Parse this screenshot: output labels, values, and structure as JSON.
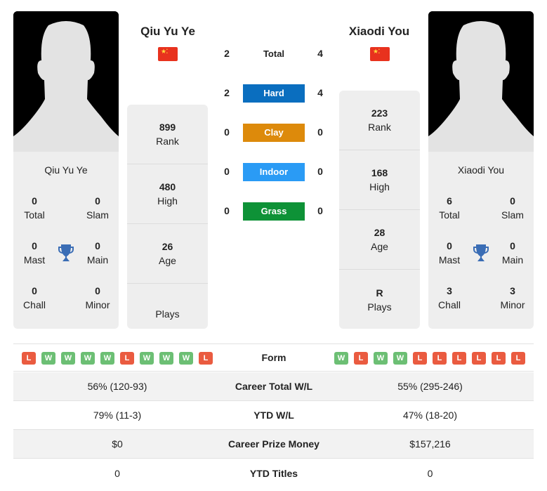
{
  "players": [
    {
      "name": "Qiu Yu Ye",
      "country_flag": "china-flag",
      "titles": {
        "total": "0",
        "slam": "0",
        "mast": "0",
        "main": "0",
        "chall": "0",
        "minor": "0"
      },
      "stats": {
        "rank": "899",
        "high": "480",
        "age": "26",
        "plays": ""
      },
      "form": [
        "L",
        "W",
        "W",
        "W",
        "W",
        "L",
        "W",
        "W",
        "W",
        "L"
      ]
    },
    {
      "name": "Xiaodi You",
      "country_flag": "china-flag",
      "titles": {
        "total": "6",
        "slam": "0",
        "mast": "0",
        "main": "0",
        "chall": "3",
        "minor": "3"
      },
      "stats": {
        "rank": "223",
        "high": "168",
        "age": "28",
        "plays": "R"
      },
      "form": [
        "W",
        "L",
        "W",
        "W",
        "L",
        "L",
        "L",
        "L",
        "L",
        "L"
      ]
    }
  ],
  "labels": {
    "total": "Total",
    "slam": "Slam",
    "mast": "Mast",
    "main": "Main",
    "chall": "Chall",
    "minor": "Minor",
    "rank": "Rank",
    "high": "High",
    "age": "Age",
    "plays": "Plays",
    "form": "Form"
  },
  "h2h": [
    {
      "label": "Total",
      "left": "2",
      "right": "4",
      "color": null
    },
    {
      "label": "Hard",
      "left": "2",
      "right": "4",
      "color": "#0a6ebf"
    },
    {
      "label": "Clay",
      "left": "0",
      "right": "0",
      "color": "#dd8a0b"
    },
    {
      "label": "Indoor",
      "left": "0",
      "right": "0",
      "color": "#2a9bf5"
    },
    {
      "label": "Grass",
      "left": "0",
      "right": "0",
      "color": "#0e9237"
    }
  ],
  "comparison": [
    {
      "label": "Career Total W/L",
      "left": "56% (120-93)",
      "right": "55% (295-246)"
    },
    {
      "label": "YTD W/L",
      "left": "79% (11-3)",
      "right": "47% (18-20)"
    },
    {
      "label": "Career Prize Money",
      "left": "$0",
      "right": "$157,216"
    },
    {
      "label": "YTD Titles",
      "left": "0",
      "right": "0"
    }
  ],
  "colors": {
    "win": "#6cbf74",
    "loss": "#ea5b40",
    "trophy": "#3a6db5"
  }
}
